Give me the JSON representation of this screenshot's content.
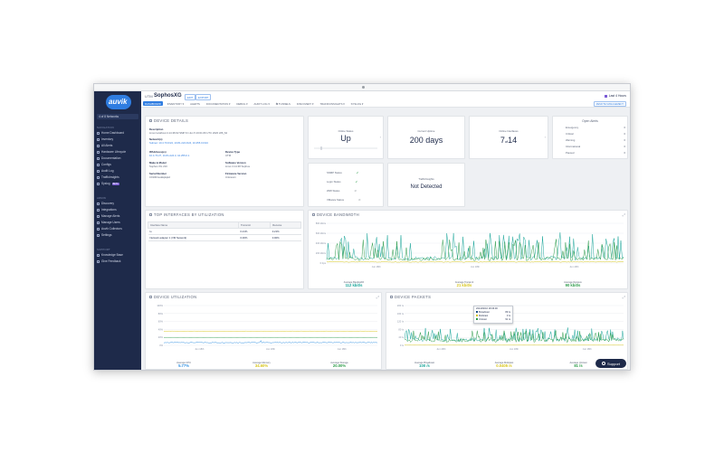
{
  "app": {
    "logo_text": "auvik"
  },
  "sidebar": {
    "network_select": "4 of 8 Networks",
    "sections": {
      "navigation": "NAVIGATION",
      "admin": "ADMIN",
      "support": "SUPPORT"
    },
    "items": [
      {
        "label": "Home Dashboard"
      },
      {
        "label": "Inventory"
      },
      {
        "label": "All Alerts"
      },
      {
        "label": "Hardware Lifecycle"
      },
      {
        "label": "Documentation"
      },
      {
        "label": "Configs"
      },
      {
        "label": "Audit Log"
      },
      {
        "label": "TrafficInsights"
      },
      {
        "label": "Syslog",
        "badge": "BETA"
      }
    ],
    "admin_items": [
      {
        "label": "Discovery"
      },
      {
        "label": "Integrations"
      },
      {
        "label": "Manage Alerts"
      },
      {
        "label": "Manage Users"
      },
      {
        "label": "Auvik Collectors"
      },
      {
        "label": "Settings"
      }
    ],
    "support_items": [
      {
        "label": "Knowledge Base"
      },
      {
        "label": "Give Feedback"
      }
    ]
  },
  "header": {
    "crumb": "UTM",
    "title": "SophosXG",
    "tag1": "EDIT",
    "tag2": "EXPORT",
    "time_range": "Last 4 Hours",
    "remote": "REMOTE MANAGEMENT",
    "tabs": [
      {
        "label": "DASHBOARD",
        "active": true
      },
      {
        "label": "INVENTORY ▾"
      },
      {
        "label": "ALERTS"
      },
      {
        "label": "DOCUMENTATION ▾"
      },
      {
        "label": "DEBUG ▾"
      },
      {
        "label": "AUDIT LOG ▾"
      },
      {
        "label": "⇆ TUNNELS"
      },
      {
        "label": "DISCOVERY ▾"
      },
      {
        "label": "TRAFFICINSIGHTS ▾"
      },
      {
        "label": "SYSLOG ▾"
      }
    ]
  },
  "device_details": {
    "title": "DEVICE DETAILS",
    "description_label": "Description",
    "description": "Linux localhost 4.14.38 #2 SMP Fri Jun 5 23:01:06 UTC 2020 x86_64",
    "networks_label": "Network(s)",
    "networks": "Subnet: 10.4.70.0/24, 10.81.224.0/24, 10.255.0.0/24",
    "ip_label": "IPAddress(es)",
    "ip": "10.4.70.27, 10.81.224.3, 10.255.0.1",
    "type_label": "Device Type",
    "type": "UTM",
    "make_label": "Make & Model",
    "make": "Sophos XG 210",
    "sw_label": "Software Version",
    "sw": "Linux 4.14.38 Sophos",
    "serial_label": "Serial Number",
    "serial": "C01001vekkqkqkd",
    "fw_label": "Firmware Version",
    "fw": "Unknown"
  },
  "online_status": {
    "label": "Online Status",
    "value": "Up"
  },
  "uptime": {
    "label": "Current Uptime",
    "value": "200 days"
  },
  "interfaces": {
    "label": "Online Interfaces",
    "value_a": "7",
    "value_sep": "of",
    "value_b": "14"
  },
  "alerts": {
    "title": "Open Alerts",
    "rows": [
      {
        "label": "Emergency",
        "count": "0"
      },
      {
        "label": "Critical",
        "count": "0"
      },
      {
        "label": "Warning",
        "count": "0"
      },
      {
        "label": "Informational",
        "count": "0"
      },
      {
        "label": "Paused",
        "count": "0"
      }
    ]
  },
  "statuses": {
    "rows": [
      {
        "label": "SNMP Status",
        "icon": "check"
      },
      {
        "label": "Login Status",
        "icon": "check"
      },
      {
        "label": "WMI Status",
        "icon": "none"
      },
      {
        "label": "VMware Status",
        "icon": "none"
      }
    ]
  },
  "traffic_insights": {
    "label": "TrafficInsights",
    "value": "Not Detected"
  },
  "top_interfaces": {
    "title": "TOP INTERFACES BY UTILIZATION",
    "columns": [
      "Interface Name",
      "Transmit",
      "Receive"
    ],
    "rows": [
      [
        "lo",
        "0.21%",
        "0.21%"
      ],
      [
        "Network adapter 1 (VM Network)",
        "0.00%",
        "0.00%"
      ]
    ]
  },
  "bandwidth": {
    "title": "DEVICE BANDWIDTH",
    "y_ticks": [
      "800 kbit/s",
      "600 kbit/s",
      "400 kbit/s",
      "200 kbit/s",
      "0 bps"
    ],
    "x_ticks": [
      "Jun 18th",
      "Jun 18th",
      "Jun 18th"
    ],
    "avg_bw_label": "Average Bandwidth",
    "avg_bw": "112 kbit/s",
    "avg_tx_label": "Average Transmit",
    "avg_tx": "21 kbit/s",
    "avg_rx_label": "Average Receive",
    "avg_rx": "90 kbit/s",
    "colors": {
      "bandwidth": "#1aa59a",
      "transmit": "#d7c51b",
      "receive": "#2d9c4a"
    }
  },
  "utilization": {
    "title": "DEVICE UTILIZATION",
    "y_ticks": [
      "100%",
      "80%",
      "60%",
      "40%",
      "20%",
      "0%"
    ],
    "x_ticks": [
      "Jun 18th",
      "Jun 18th",
      "Jun 18th"
    ],
    "avg_cpu_label": "Average CPU",
    "avg_cpu": "5.77%",
    "avg_mem_label": "Average Memory",
    "avg_mem": "34.60%",
    "avg_storage_label": "Average Storage",
    "avg_storage": "20.00%",
    "colors": {
      "cpu": "#2f8fe1",
      "memory": "#d7c51b",
      "storage": "#2d9c4a"
    }
  },
  "packets": {
    "title": "DEVICE PACKETS",
    "y_ticks": [
      "200 /s",
      "160 /s",
      "120 /s",
      "80 /s",
      "40 /s",
      "0 /s"
    ],
    "x_ticks": [
      "Jun 18th",
      "Jun 18th",
      "Jun 18th"
    ],
    "tooltip": {
      "time": "2021/03/16 18:36:00",
      "rows": [
        {
          "label": "Broadcast",
          "value": "89 /s",
          "color": "#1e4c8a"
        },
        {
          "label": "Multicast",
          "value": "0 /s",
          "color": "#d7c51b"
        },
        {
          "label": "Unicast",
          "value": "91 /s",
          "color": "#2d9c4a"
        }
      ]
    },
    "avg_bc_label": "Average Broadcast",
    "avg_bc": "100 /s",
    "avg_mc_label": "Average Multicast",
    "avg_mc": "0.0405 /s",
    "avg_uc_label": "Average Unicast",
    "avg_uc": "81 /s",
    "colors": {
      "broadcast": "#1aa59a",
      "multicast": "#d7c51b",
      "unicast": "#2d9c4a"
    }
  },
  "support": {
    "label": "Support"
  }
}
